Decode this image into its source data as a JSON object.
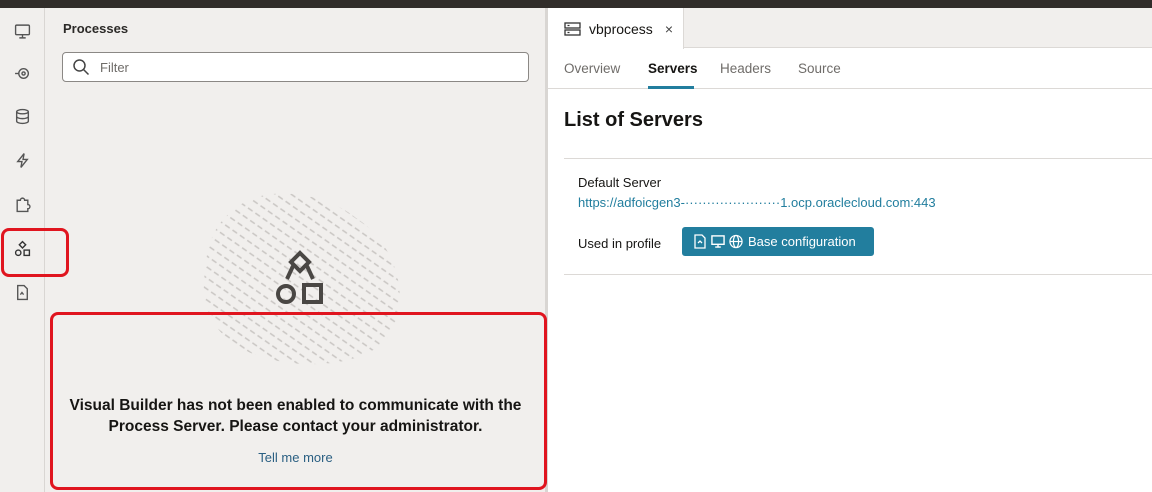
{
  "rail": {
    "items": [
      {
        "name": "web-apps-icon"
      },
      {
        "name": "services-icon"
      },
      {
        "name": "business-objects-icon"
      },
      {
        "name": "components-icon"
      },
      {
        "name": "source-files-icon"
      },
      {
        "name": "processes-icon",
        "selected": true
      },
      {
        "name": "mobile-files-icon"
      }
    ]
  },
  "processes_panel": {
    "title": "Processes",
    "filter_placeholder": "Filter",
    "empty_message": "Visual Builder has not been enabled to communicate with the Process Server. Please contact your administrator.",
    "tell_me_more": "Tell me more"
  },
  "editor": {
    "file_tab": {
      "label": "vbprocess",
      "close": "×"
    },
    "tabs": [
      {
        "label": "Overview",
        "active": false
      },
      {
        "label": "Servers",
        "active": true
      },
      {
        "label": "Headers",
        "active": false
      },
      {
        "label": "Source",
        "active": false
      }
    ],
    "section_title": "List of Servers",
    "server": {
      "name": "Default Server",
      "url": "https://adfoicgen3-······················1.ocp.oraclecloud.com:443",
      "used_in_label": "Used in profile",
      "profile_button": "Base configuration"
    }
  },
  "colors": {
    "accent": "#227e9e",
    "highlight": "#e0151f",
    "topbar": "#312d2a"
  }
}
